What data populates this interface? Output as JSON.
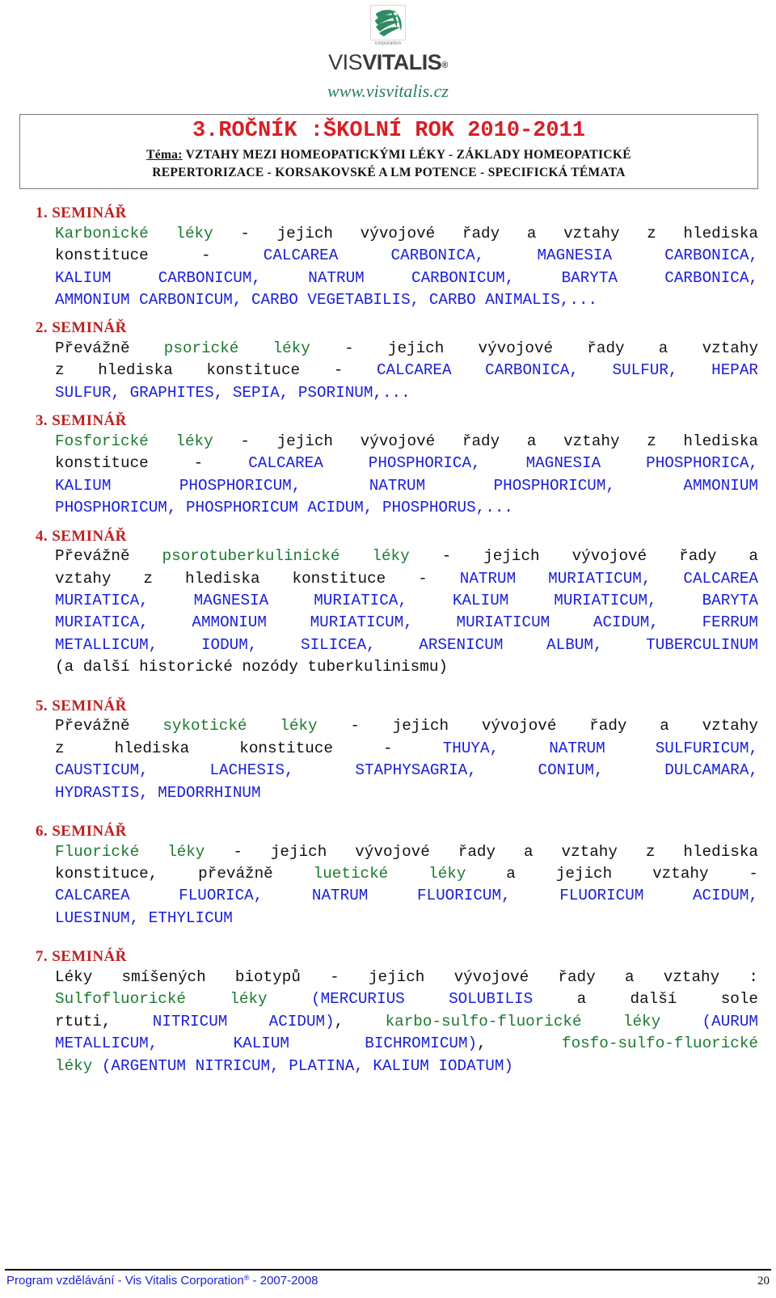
{
  "logo": {
    "mark_alt": "green-brush-strokes-mark",
    "corporation_label": "corporation",
    "word_first": "VIS",
    "word_second": "VITALIS",
    "registered_mark": "®",
    "brand_green": "#2e8b62"
  },
  "site_url": "www.visvitalis.cz",
  "title_box": {
    "heading": "3.ROČNÍK :ŠKOLNÍ ROK 2010-2011",
    "heading_color": "#d81f26",
    "topic_label": "Téma:",
    "topic_line1": " VZTAHY MEZI HOMEOPATICKÝMI LÉKY - ZÁKLADY HOMEOPATICKÉ",
    "topic_line2": "REPERTORIZACE - KORSAKOVSKÉ A LM POTENCE - SPECIFICKÁ TÉMATA"
  },
  "colors": {
    "heading_red": "#c0201f",
    "class_green": "#1a7a2e",
    "remedy_blue": "#1b20d8",
    "body_black": "#111111"
  },
  "seminars": [
    {
      "heading": "1. SEMINÁŘ",
      "lines": [
        [
          {
            "t": "Karbonické léky",
            "c": "g"
          },
          {
            "t": " - jejich vývojové řady a vztahy z hlediska",
            "c": "k"
          }
        ],
        [
          {
            "t": "konstituce  -  ",
            "c": "k"
          },
          {
            "t": "CALCAREA  CARBONICA,  MAGNESIA  CARBONICA,",
            "c": "b"
          }
        ],
        [
          {
            "t": "KALIUM CARBONICUM, NATRUM CARBONICUM, BARYTA CARBONICA,",
            "c": "b"
          }
        ],
        [
          {
            "t": "AMMONIUM CARBONICUM, CARBO VEGETABILIS, CARBO ANIMALIS,...",
            "c": "b"
          }
        ]
      ]
    },
    {
      "heading": "2. SEMINÁŘ",
      "lines": [
        [
          {
            "t": "Převážně ",
            "c": "k"
          },
          {
            "t": "psorické léky",
            "c": "g"
          },
          {
            "t": " - jejich vývojové řady a vztahy",
            "c": "k"
          }
        ],
        [
          {
            "t": "z hlediska konstituce - ",
            "c": "k"
          },
          {
            "t": "CALCAREA CARBONICA, SULFUR, HEPAR",
            "c": "b"
          }
        ],
        [
          {
            "t": "SULFUR, GRAPHITES,  SEPIA, PSORINUM,...",
            "c": "b"
          }
        ]
      ]
    },
    {
      "heading": "3. SEMINÁŘ",
      "lines": [
        [
          {
            "t": "Fosforické léky",
            "c": "g"
          },
          {
            "t": " - jejich vývojové řady a vztahy z hlediska",
            "c": "k"
          }
        ],
        [
          {
            "t": "konstituce - ",
            "c": "k"
          },
          {
            "t": "CALCAREA PHOSPHORICA, MAGNESIA PHOSPHORICA,",
            "c": "b"
          }
        ],
        [
          {
            "t": "KALIUM  PHOSPHORICUM,  NATRUM  PHOSPHORICUM,  AMMONIUM",
            "c": "b"
          }
        ],
        [
          {
            "t": "PHOSPHORICUM, PHOSPHORICUM ACIDUM, PHOSPHORUS,...",
            "c": "b"
          }
        ]
      ]
    },
    {
      "heading": "4. SEMINÁŘ",
      "lines": [
        [
          {
            "t": "Převážně ",
            "c": "k"
          },
          {
            "t": "psorotuberkulinické léky",
            "c": "g"
          },
          {
            "t": " - jejich vývojové řady a",
            "c": "k"
          }
        ],
        [
          {
            "t": "vztahy z hlediska konstituce - ",
            "c": "k"
          },
          {
            "t": "NATRUM MURIATICUM, CALCAREA",
            "c": "b"
          }
        ],
        [
          {
            "t": "MURIATICA, MAGNESIA MURIATICA, KALIUM MURIATICUM, BARYTA",
            "c": "b"
          }
        ],
        [
          {
            "t": "MURIATICA, AMMONIUM MURIATICUM, MURIATICUM ACIDUM, FERRUM",
            "c": "b"
          }
        ],
        [
          {
            "t": "METALLICUM, IODUM, SILICEA, ARSENICUM ALBUM, TUBERCULINUM",
            "c": "b"
          }
        ],
        [
          {
            "t": "(a další historické nozódy tuberkulinismu)",
            "c": "k"
          }
        ]
      ]
    },
    {
      "heading": "5. SEMINÁŘ",
      "lines": [
        [
          {
            "t": "Převážně ",
            "c": "k"
          },
          {
            "t": "sykotické léky",
            "c": "g"
          },
          {
            "t": " - jejich vývojové řady a vztahy",
            "c": "k"
          }
        ],
        [
          {
            "t": "z hlediska  konstituce  -  ",
            "c": "k"
          },
          {
            "t": "THUYA,  NATRUM  SULFURICUM,",
            "c": "b"
          }
        ],
        [
          {
            "t": "CAUSTICUM,  LACHESIS,  STAPHYSAGRIA,  CONIUM,  DULCAMARA,",
            "c": "b"
          }
        ],
        [
          {
            "t": "HYDRASTIS, MEDORRHINUM",
            "c": "b"
          }
        ]
      ]
    },
    {
      "heading": "6. SEMINÁŘ",
      "lines": [
        [
          {
            "t": "Fluorické léky",
            "c": "g"
          },
          {
            "t": " - jejich vývojové řady a vztahy z hlediska",
            "c": "k"
          }
        ],
        [
          {
            "t": "konstituce, převážně ",
            "c": "k"
          },
          {
            "t": "luetické léky",
            "c": "g"
          },
          {
            "t": " a jejich vztahy -",
            "c": "k"
          }
        ],
        [
          {
            "t": "CALCAREA FLUORICA, NATRUM FLUORICUM, FLUORICUM ACIDUM,",
            "c": "b"
          }
        ],
        [
          {
            "t": "LUESINUM, ETHYLICUM",
            "c": "b"
          }
        ]
      ]
    },
    {
      "heading": "7. SEMINÁŘ",
      "lines": [
        [
          {
            "t": "Léky smíšených biotypů - jejich vývojové řady a vztahy :",
            "c": "k"
          }
        ],
        [
          {
            "t": "Sulfofluorické léky ",
            "c": "g"
          },
          {
            "t": "(MERCURIUS SOLUBILIS ",
            "c": "b"
          },
          {
            "t": "a další sole",
            "c": "k"
          }
        ],
        [
          {
            "t": "rtuti, ",
            "c": "k"
          },
          {
            "t": "NITRICUM ACIDUM)",
            "c": "b"
          },
          {
            "t": ", ",
            "c": "k"
          },
          {
            "t": "karbo-sulfo-fluorické léky ",
            "c": "g"
          },
          {
            "t": "(AURUM",
            "c": "b"
          }
        ],
        [
          {
            "t": "METALLICUM,  KALIUM  BICHROMICUM)",
            "c": "b"
          },
          {
            "t": ",  ",
            "c": "k"
          },
          {
            "t": "fosfo-sulfo-fluorické",
            "c": "g"
          }
        ],
        [
          {
            "t": "léky ",
            "c": "g"
          },
          {
            "t": "(ARGENTUM NITRICUM, PLATINA, KALIUM IODATUM)",
            "c": "b"
          }
        ]
      ]
    }
  ],
  "footer": {
    "text_before_reg": "Program  vzdělávání - Vis Vitalis Corporation",
    "registered_mark": "®",
    "text_after_reg": " - 2007-2008",
    "page_number": "20"
  }
}
